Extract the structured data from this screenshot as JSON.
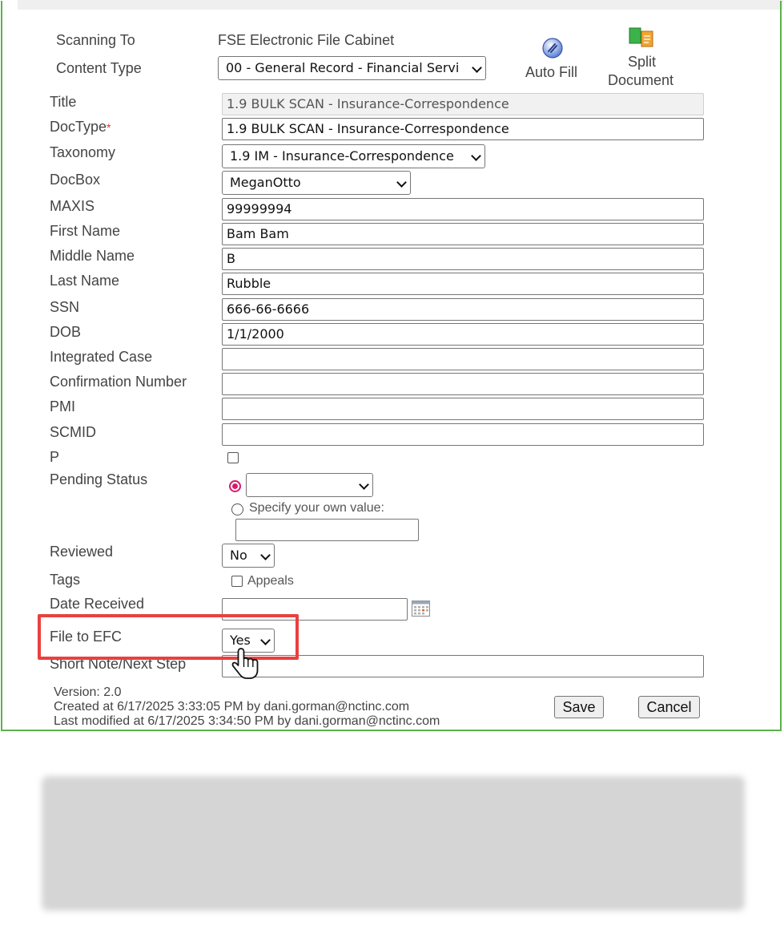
{
  "header": {
    "scanning_to_label": "Scanning To",
    "scanning_to_value": "FSE Electronic File Cabinet",
    "content_type_label": "Content Type",
    "content_type_value": "00 - General Record - Financial Servi",
    "auto_fill_label": "Auto Fill",
    "split_label_1": "Split",
    "split_label_2": "Document"
  },
  "fields": {
    "title": {
      "label": "Title",
      "value": "1.9 BULK SCAN - Insurance-Correspondence"
    },
    "doctype": {
      "label": "DocType",
      "value": "1.9 BULK SCAN - Insurance-Correspondence",
      "required_mark": "*"
    },
    "taxonomy": {
      "label": "Taxonomy",
      "value": "1.9 IM - Insurance-Correspondence"
    },
    "docbox": {
      "label": "DocBox",
      "value": "MeganOtto"
    },
    "maxis": {
      "label": "MAXIS",
      "value": "99999994"
    },
    "first_name": {
      "label": "First Name",
      "value": "Bam Bam"
    },
    "middle_name": {
      "label": "Middle Name",
      "value": "B"
    },
    "last_name": {
      "label": "Last Name",
      "value": "Rubble"
    },
    "ssn": {
      "label": "SSN",
      "value": "666-66-6666"
    },
    "dob": {
      "label": "DOB",
      "value": "1/1/2000"
    },
    "integrated_case": {
      "label": "Integrated Case",
      "value": ""
    },
    "confirmation_number": {
      "label": "Confirmation Number",
      "value": ""
    },
    "pmi": {
      "label": "PMI",
      "value": ""
    },
    "scmid": {
      "label": "SCMID",
      "value": ""
    },
    "p": {
      "label": "P"
    },
    "pending_status": {
      "label": "Pending Status",
      "selected_value": "",
      "specify_label": "Specify your own value:",
      "specify_value": ""
    },
    "reviewed": {
      "label": "Reviewed",
      "value": "No"
    },
    "tags": {
      "label": "Tags",
      "option": "Appeals"
    },
    "date_received": {
      "label": "Date Received",
      "value": ""
    },
    "file_to_efc": {
      "label": "File to EFC",
      "value": "Yes"
    },
    "short_note": {
      "label": "Short Note/Next Step",
      "value": ""
    }
  },
  "footer": {
    "version": "Version: 2.0",
    "created": "Created at 6/17/2025 3:33:05 PM by dani.gorman@nctinc.com",
    "modified": "Last modified at 6/17/2025 3:34:50 PM by dani.gorman@nctinc.com",
    "save_label": "Save",
    "cancel_label": "Cancel"
  },
  "colors": {
    "frame": "#5bb24a",
    "highlight": "#e8413f",
    "radio_selected": "#d6196e"
  }
}
